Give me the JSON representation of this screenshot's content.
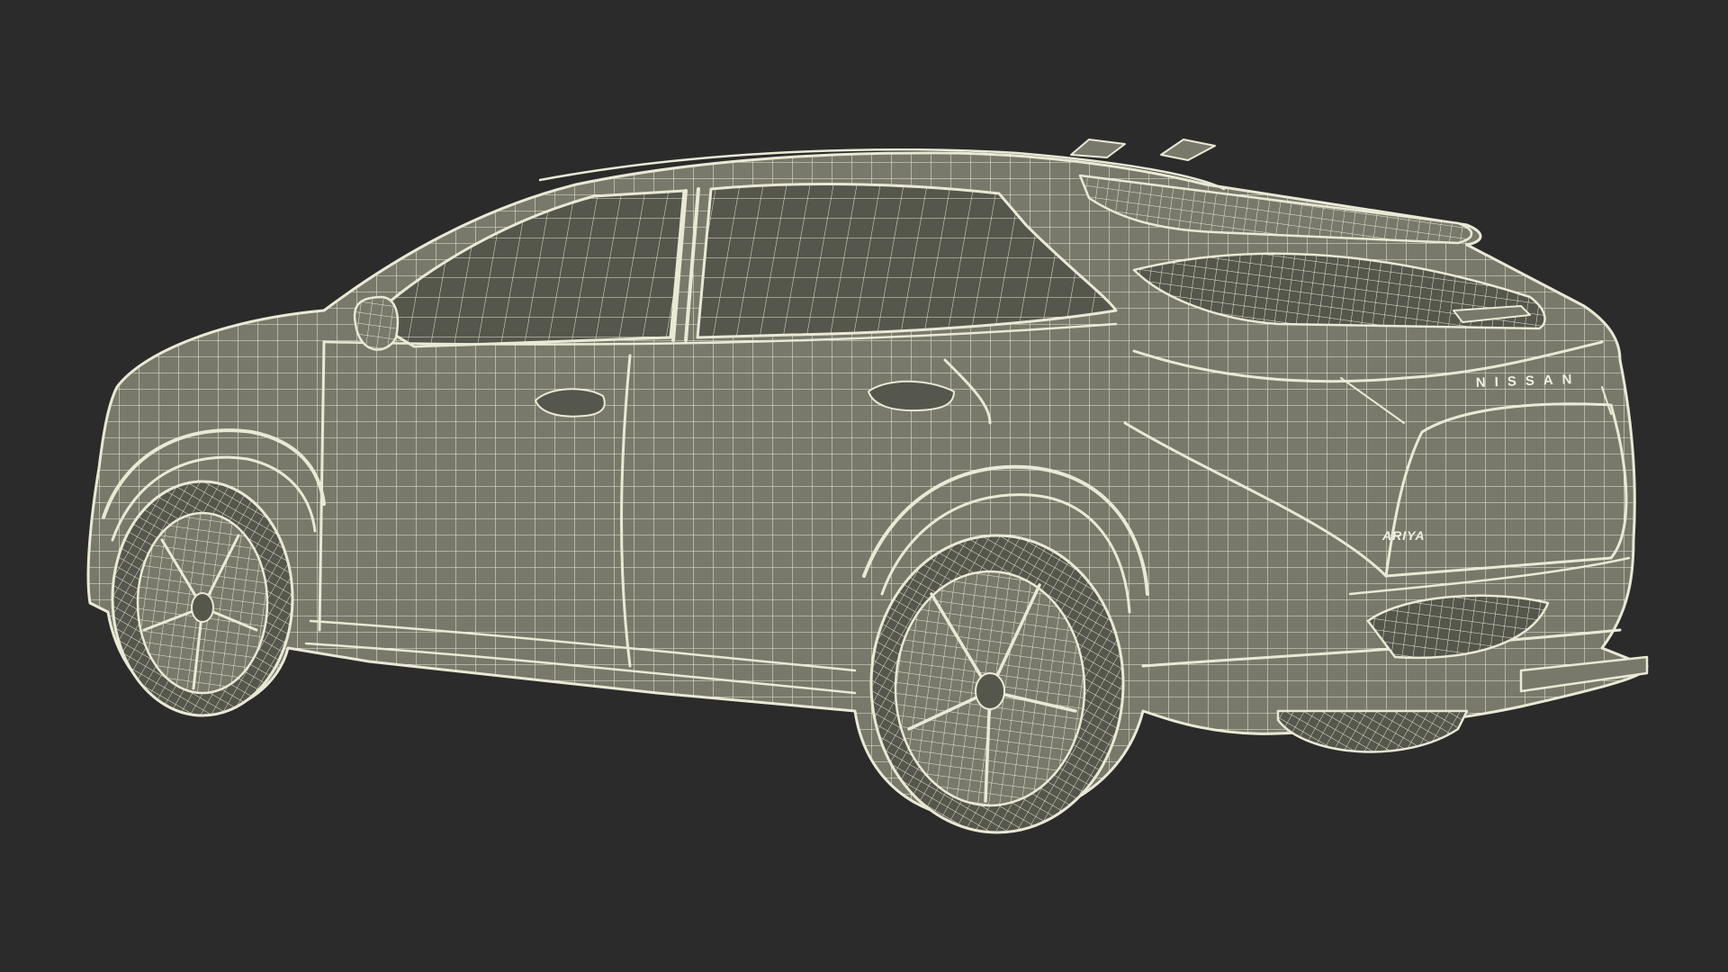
{
  "scene": {
    "description_free": true,
    "background_color": "#2b2b2b",
    "mesh_fill_color": "#78796b",
    "wire_color": "#e9e9d6"
  },
  "badges": {
    "brand": "NISSAN",
    "model": "ARIYA"
  }
}
